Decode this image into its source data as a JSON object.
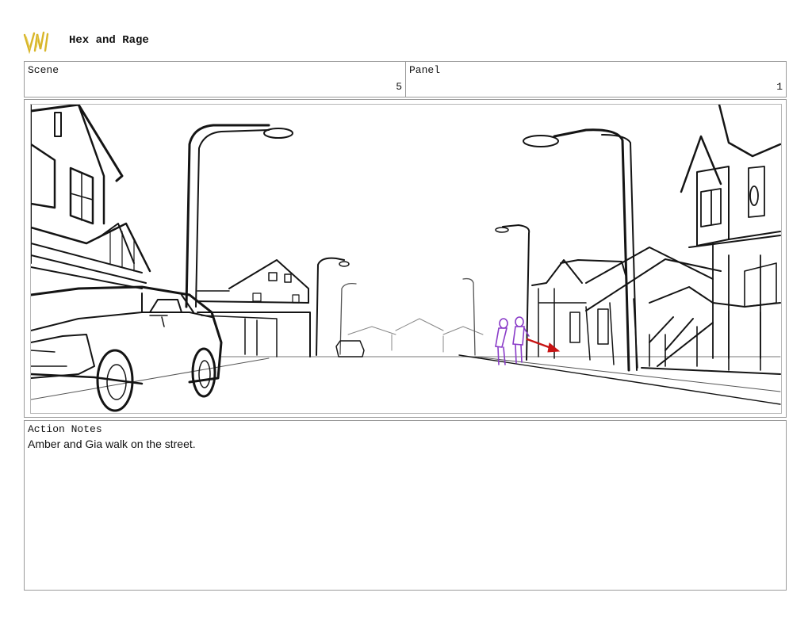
{
  "header": {
    "logo_icon": "vm-logo-icon",
    "title": "Hex and Rage"
  },
  "scene": {
    "label": "Scene",
    "value": "5"
  },
  "panel": {
    "label": "Panel",
    "value": "1"
  },
  "artwork": {
    "description_icon": "street-sketch",
    "character_color": "#8a3cc8",
    "arrow_color": "#c81414"
  },
  "notes": {
    "label": "Action Notes",
    "text": "Amber and Gia walk on the street."
  }
}
